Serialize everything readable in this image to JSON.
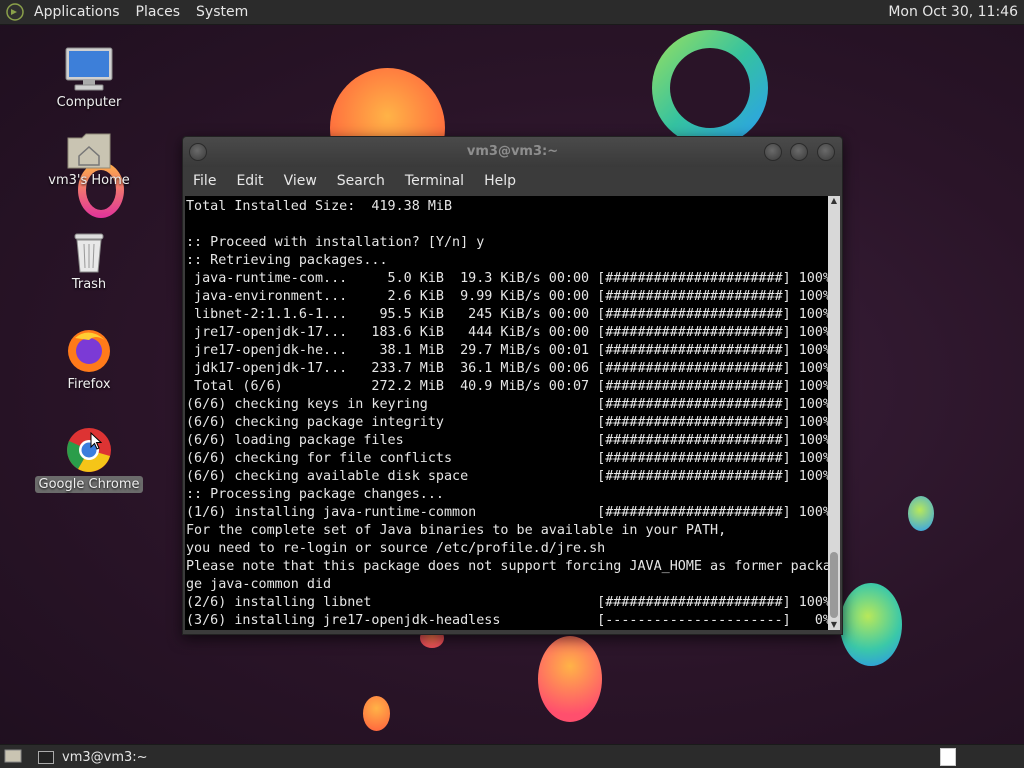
{
  "top_panel": {
    "menus": [
      "Applications",
      "Places",
      "System"
    ],
    "clock": "Mon Oct 30, 11:46"
  },
  "desktop_icons": {
    "computer": "Computer",
    "home": "vm3's Home",
    "trash": "Trash",
    "firefox": "Firefox",
    "chrome": "Google Chrome"
  },
  "terminal": {
    "title": "vm3@vm3:~",
    "menus": [
      "File",
      "Edit",
      "View",
      "Search",
      "Terminal",
      "Help"
    ],
    "lines": [
      "Total Installed Size:  419.38 MiB",
      "",
      ":: Proceed with installation? [Y/n] y",
      ":: Retrieving packages...",
      " java-runtime-com...     5.0 KiB  19.3 KiB/s 00:00 [######################] 100%",
      " java-environment...     2.6 KiB  9.99 KiB/s 00:00 [######################] 100%",
      " libnet-2:1.1.6-1...    95.5 KiB   245 KiB/s 00:00 [######################] 100%",
      " jre17-openjdk-17...   183.6 KiB   444 KiB/s 00:00 [######################] 100%",
      " jre17-openjdk-he...    38.1 MiB  29.7 MiB/s 00:01 [######################] 100%",
      " jdk17-openjdk-17...   233.7 MiB  36.1 MiB/s 00:06 [######################] 100%",
      " Total (6/6)           272.2 MiB  40.9 MiB/s 00:07 [######################] 100%",
      "(6/6) checking keys in keyring                     [######################] 100%",
      "(6/6) checking package integrity                   [######################] 100%",
      "(6/6) loading package files                        [######################] 100%",
      "(6/6) checking for file conflicts                  [######################] 100%",
      "(6/6) checking available disk space                [######################] 100%",
      ":: Processing package changes...",
      "(1/6) installing java-runtime-common               [######################] 100%",
      "For the complete set of Java binaries to be available in your PATH,",
      "you need to re-login or source /etc/profile.d/jre.sh",
      "Please note that this package does not support forcing JAVA_HOME as former packa",
      "ge java-common did",
      "(2/6) installing libnet                            [######################] 100%",
      "(3/6) installing jre17-openjdk-headless            [----------------------]   0%"
    ]
  },
  "taskbar": {
    "task_label": "vm3@vm3:~"
  },
  "colors": {
    "panel": "#2b2b2b",
    "terminal_bg": "#000000",
    "terminal_fg": "#e6e6e6",
    "selection": "#6b6b6b"
  }
}
